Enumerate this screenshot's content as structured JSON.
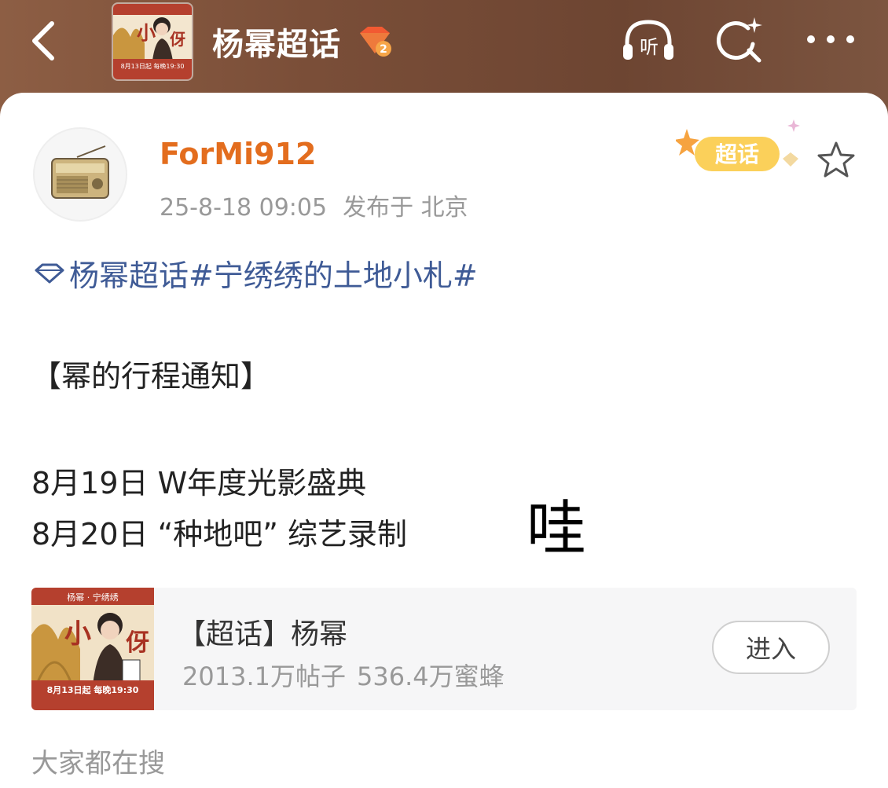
{
  "header": {
    "title": "杨幂超话",
    "level_badge": "2",
    "back_icon": "chevron-left-icon",
    "listen_label": "听",
    "icons": [
      "headphones-icon",
      "search-sparkle-icon",
      "more-dots-icon"
    ],
    "cover_text": {
      "show": "宁绣绣",
      "date": "8月13日起 每晚19:30"
    }
  },
  "post": {
    "username": "ForMi912",
    "timestamp": "25-8-18 09:05",
    "location": "发布于 北京",
    "tag_label": "超话",
    "topic_link": "杨幂超话",
    "hashtag": "#宁绣绣的土地小札#",
    "lines": [
      "【幂的行程通知】",
      "8月19日 W年度光影盛典",
      "8月20日 “种地吧” 综艺录制"
    ],
    "overlay_text": "哇"
  },
  "topic_card": {
    "title": "【超话】杨幂",
    "posts": "2013.1万帖子",
    "fans": "536.4万蜜蜂",
    "button": "进入",
    "cover_text": {
      "top": "杨幂 · 宁绣绣",
      "date": "8月13日起 每晚19:30"
    }
  },
  "section": {
    "search_heading": "大家都在搜"
  },
  "colors": {
    "header_bg": "#7a4e38",
    "username": "#e36d1e",
    "topic_link": "#3f5b96",
    "card_bg": "#f6f6f7"
  }
}
